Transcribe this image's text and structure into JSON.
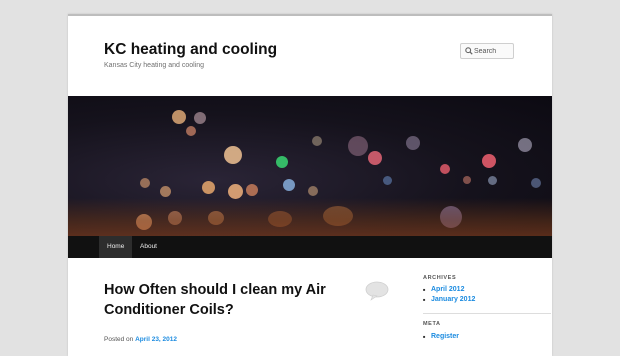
{
  "site": {
    "title": "KC heating and cooling",
    "description": "Kansas City heating and cooling"
  },
  "search": {
    "placeholder": "Search",
    "icon": "search-icon"
  },
  "nav": {
    "items": [
      {
        "label": "Home",
        "active": true
      },
      {
        "label": "About",
        "active": false
      }
    ]
  },
  "post": {
    "title": "How Often should I clean my Air Conditioner Coils?",
    "posted_prefix": "Posted on",
    "date": "April 23, 2012",
    "comment_icon": "comment-bubble-icon"
  },
  "sidebar": {
    "archives": {
      "title": "ARCHIVES",
      "items": [
        "April 2012",
        "January 2012"
      ]
    },
    "meta": {
      "title": "META",
      "items": [
        "Register"
      ]
    }
  },
  "colors": {
    "link": "#1b8be0",
    "nav_bg": "#111111",
    "page_bg": "#e2e2e2"
  }
}
